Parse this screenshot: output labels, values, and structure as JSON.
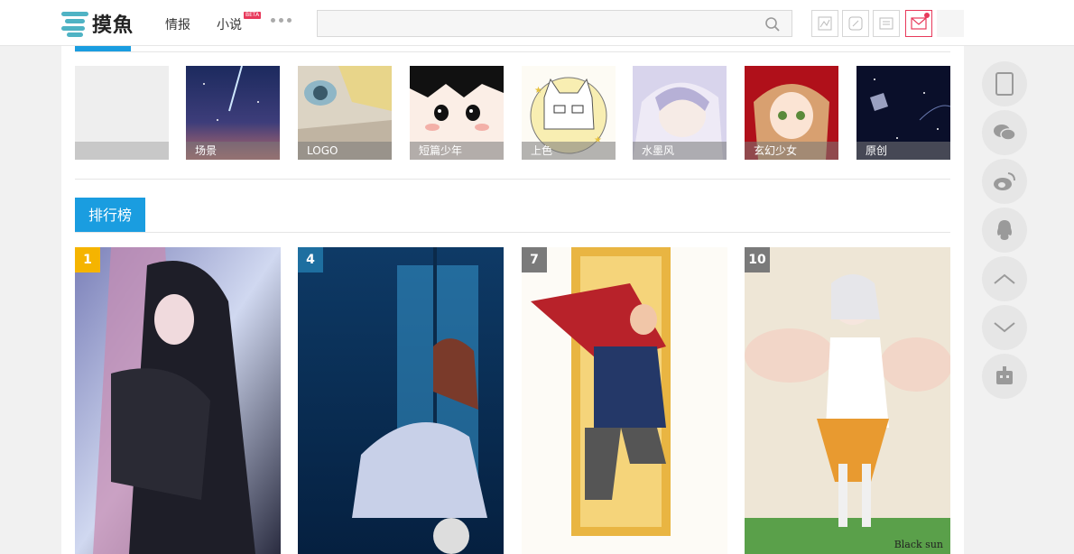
{
  "header": {
    "logo_text": "摸魚",
    "nav": [
      {
        "label": "情报"
      },
      {
        "label": "小说",
        "badge": "BETA"
      }
    ],
    "search_placeholder": "",
    "accent": "#e8395b"
  },
  "tags": [
    {
      "label": ""
    },
    {
      "label": "场景"
    },
    {
      "label": "LOGO"
    },
    {
      "label": "短篇少年"
    },
    {
      "label": "上色"
    },
    {
      "label": "水墨风"
    },
    {
      "label": "玄幻少女"
    },
    {
      "label": "原创"
    }
  ],
  "ranking": {
    "title": "排行榜",
    "accent": "#1a9de0",
    "cards": [
      {
        "rank": "1",
        "badge_color": "#f5b400"
      },
      {
        "rank": "4",
        "badge_color": "#1e6fa0"
      },
      {
        "rank": "7",
        "badge_color": "#7a7a7a"
      },
      {
        "rank": "10",
        "badge_color": "#7a7a7a",
        "signature": "Black sun"
      }
    ]
  },
  "sidebar": {
    "icons": [
      "tablet-icon",
      "wechat-icon",
      "weibo-icon",
      "qq-icon",
      "arrow-up-icon",
      "arrow-down-icon",
      "robot-icon"
    ]
  }
}
